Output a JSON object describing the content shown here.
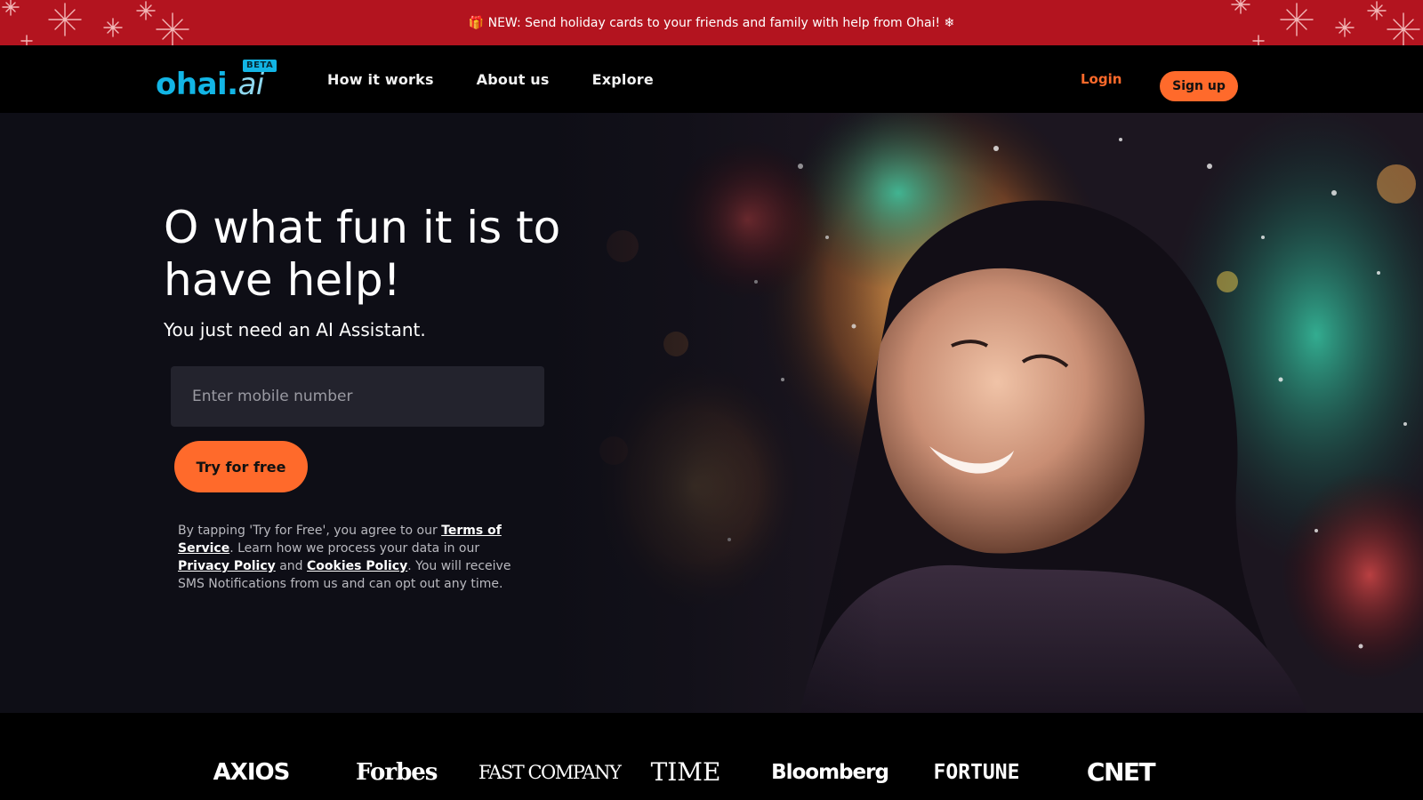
{
  "banner": {
    "text": "🎁 NEW: Send holiday cards to your friends and family with help from Ohai! ❄",
    "background": "#b3141f"
  },
  "nav": {
    "logo": {
      "wordmark": "ohai",
      "dot": ".",
      "suffix": "ai",
      "badge": "BETA"
    },
    "links": [
      "How it works",
      "About us",
      "Explore"
    ],
    "login": "Login",
    "signup": "Sign up"
  },
  "hero": {
    "title": "O what fun it is to have help!",
    "subtitle": "You just need an AI Assistant.",
    "phone_placeholder": "Enter mobile number",
    "cta": "Try for free",
    "legal": {
      "prefix": "By tapping 'Try for Free', you agree to our ",
      "terms": "Terms of Service",
      "middle": ". Learn how we process your data in our ",
      "privacy": "Privacy Policy",
      "and": " and ",
      "cookies": "Cookies Policy",
      "suffix": ". You will receive SMS Notifications from us and can opt out any time."
    }
  },
  "press": [
    "AXIOS",
    "Forbes",
    "FAST COMPANY",
    "TIME",
    "Bloomberg",
    "FORTUNE",
    "CNET"
  ],
  "colors": {
    "accent": "#ff6a2b",
    "brand": "#12b5e5",
    "hero_background": "#0e0e16",
    "input_background": "#23232d"
  }
}
